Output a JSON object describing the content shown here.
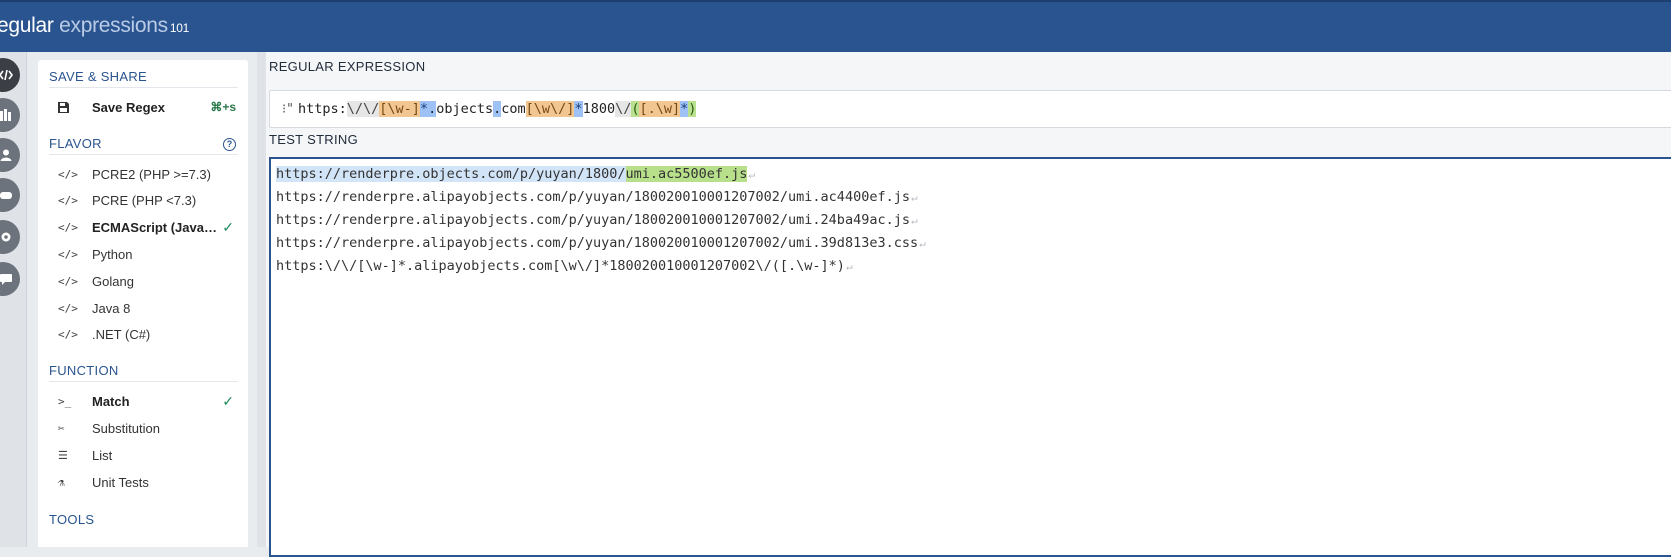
{
  "header": {
    "logo_bold": "egular",
    "logo_light": " expressions",
    "logo_version": "101"
  },
  "rail": {
    "items": [
      "code-icon",
      "library-icon",
      "account-icon",
      "quiz-icon",
      "settings-icon",
      "chat-icon"
    ]
  },
  "sidebar": {
    "save_share_title": "SAVE & SHARE",
    "save_label": "Save Regex",
    "save_shortcut": "⌘+s",
    "flavor_title": "FLAVOR",
    "flavor_help": "?",
    "flavors": [
      {
        "label": "PCRE2 (PHP >=7.3)",
        "selected": false
      },
      {
        "label": "PCRE (PHP <7.3)",
        "selected": false
      },
      {
        "label": "ECMAScript (JavaScript)",
        "selected": true
      },
      {
        "label": "Python",
        "selected": false
      },
      {
        "label": "Golang",
        "selected": false
      },
      {
        "label": "Java 8",
        "selected": false
      },
      {
        "label": ".NET (C#)",
        "selected": false
      }
    ],
    "function_title": "FUNCTION",
    "functions": [
      {
        "label": "Match",
        "selected": true
      },
      {
        "label": "Substitution",
        "selected": false
      },
      {
        "label": "List",
        "selected": false
      },
      {
        "label": "Unit Tests",
        "selected": false
      }
    ],
    "check_glyph": "✓"
  },
  "regex": {
    "title": "REGULAR EXPRESSION",
    "delimiter": "\"",
    "tokens": [
      {
        "t": "https:",
        "k": ""
      },
      {
        "t": "\\/",
        "k": "esc"
      },
      {
        "t": "\\/",
        "k": "esc"
      },
      {
        "t": "[\\w-]",
        "k": "set"
      },
      {
        "t": "*",
        "k": "q"
      },
      {
        "t": ".",
        "k": "dot"
      },
      {
        "t": "objects",
        "k": ""
      },
      {
        "t": ".",
        "k": "dot"
      },
      {
        "t": "com",
        "k": ""
      },
      {
        "t": "[\\w\\/]",
        "k": "set"
      },
      {
        "t": "*",
        "k": "q"
      },
      {
        "t": "1800",
        "k": ""
      },
      {
        "t": "\\/",
        "k": "esc"
      },
      {
        "t": "(",
        "k": "grp"
      },
      {
        "t": "[.\\w]",
        "k": "set"
      },
      {
        "t": "*",
        "k": "q"
      },
      {
        "t": ")",
        "k": "grp"
      }
    ]
  },
  "test": {
    "title": "TEST STRING",
    "eol_glyph": "↵",
    "line1_match": "https://renderpre.objects.com/p/yuyan/1800/",
    "line1_group": "umi.ac5500ef.js",
    "lines": [
      "https://renderpre.alipayobjects.com/p/yuyan/180020010001207002/umi.ac4400ef.js",
      "https://renderpre.alipayobjects.com/p/yuyan/180020010001207002/umi.24ba49ac.js",
      "https://renderpre.alipayobjects.com/p/yuyan/180020010001207002/umi.39d813e3.css",
      "https:\\/\\/[\\w-]*.alipayobjects.com[\\w\\/]*180020010001207002\\/([.\\w-]*)"
    ]
  }
}
